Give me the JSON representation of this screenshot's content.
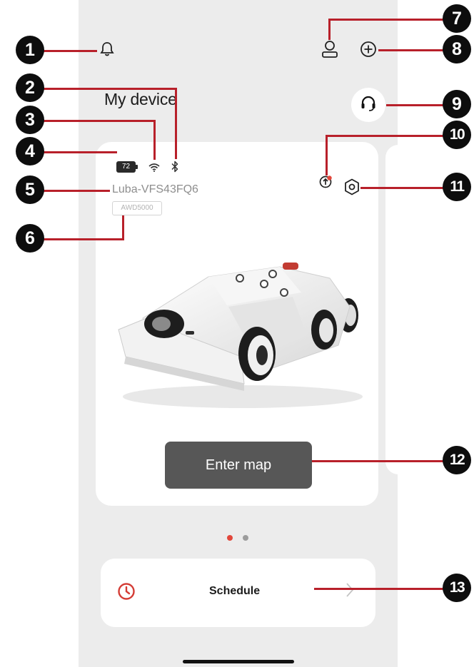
{
  "header": {
    "title": "My device",
    "icons": {
      "notifications": "bell-icon",
      "account": "user-icon",
      "add": "plus-circle-icon",
      "support": "headset-icon"
    }
  },
  "device_card": {
    "battery_percent": "72",
    "status_icons": [
      "wifi-icon",
      "bluetooth-icon"
    ],
    "action_icons": [
      "update-icon",
      "settings-icon"
    ],
    "update_badge_color": "#e2473b",
    "device_name": "Luba-VFS43FQ6",
    "model": "AWD5000",
    "enter_map_label": "Enter map"
  },
  "pager": {
    "count": 2,
    "active_index": 0,
    "active_color": "#e2473b"
  },
  "schedule": {
    "label": "Schedule",
    "icon": "clock-icon",
    "accent_color": "#d43c35"
  },
  "callouts": [
    "1",
    "2",
    "3",
    "4",
    "5",
    "6",
    "7",
    "8",
    "9",
    "10",
    "11",
    "12",
    "13"
  ],
  "colors": {
    "callout_line": "#b8202a",
    "callout_badge": "#0d0d0d"
  }
}
